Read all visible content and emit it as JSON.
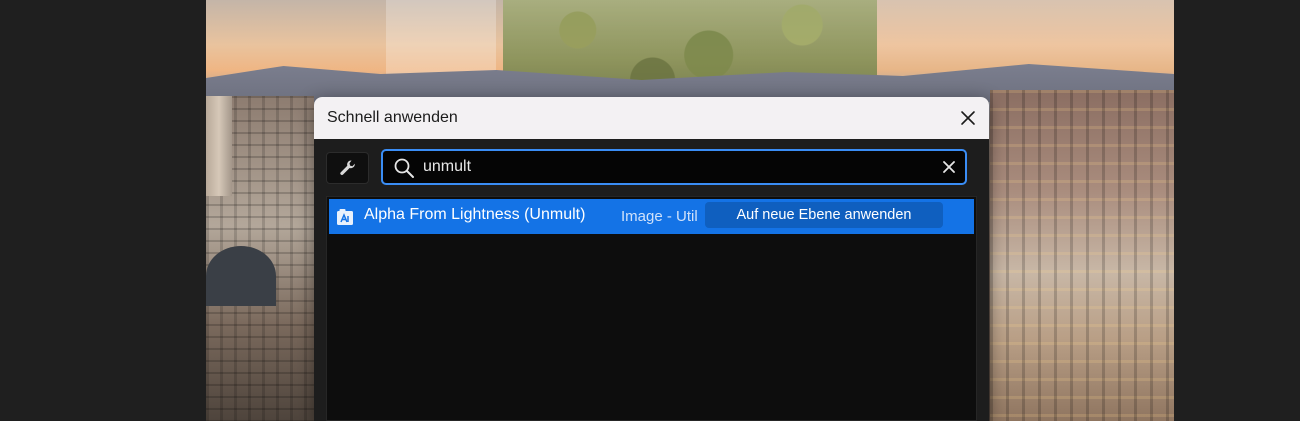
{
  "dialog": {
    "title": "Schnell anwenden",
    "close_icon": "close-icon",
    "tool_icon": "wrench-icon"
  },
  "search": {
    "value": "unmult",
    "icon": "search-icon",
    "clear_icon": "clear-icon"
  },
  "results": [
    {
      "name": "Alpha From Lightness (Unmult)",
      "category": "Image - Util",
      "action_label": "Auf neue Ebene anwenden",
      "icon": "effect-preset-icon",
      "selected": true
    }
  ],
  "colors": {
    "accent": "#1473e6",
    "focus_border": "#3a8df5",
    "title_bar": "#f3f1f3",
    "dialog_body": "#1d1d1d"
  }
}
